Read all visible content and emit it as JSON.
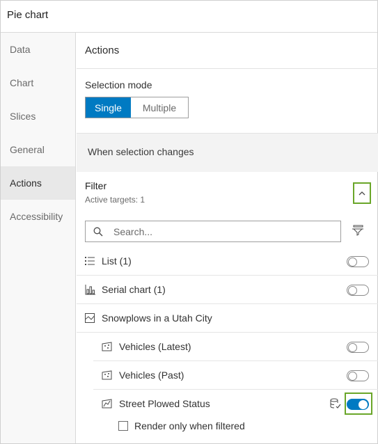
{
  "panel": {
    "title": "Pie chart"
  },
  "sidebar": {
    "items": [
      {
        "label": "Data"
      },
      {
        "label": "Chart"
      },
      {
        "label": "Slices"
      },
      {
        "label": "General"
      },
      {
        "label": "Actions",
        "active": true
      },
      {
        "label": "Accessibility"
      }
    ]
  },
  "main": {
    "title": "Actions",
    "selection_mode": {
      "label": "Selection mode",
      "options": [
        "Single",
        "Multiple"
      ],
      "selected": "Single"
    },
    "when_changes": "When selection changes",
    "filter": {
      "title": "Filter",
      "active_targets": "Active targets: 1",
      "search_placeholder": "Search...",
      "targets": [
        {
          "label": "List (1)",
          "icon": "list-icon",
          "enabled": false
        },
        {
          "label": "Serial chart (1)",
          "icon": "serial-chart-icon",
          "enabled": false
        },
        {
          "label": "Snowplows in a Utah City",
          "icon": "map-icon",
          "group": true
        },
        {
          "label": "Vehicles (Latest)",
          "icon": "point-layer-icon",
          "enabled": false
        },
        {
          "label": "Vehicles (Past)",
          "icon": "point-layer-icon",
          "enabled": false
        },
        {
          "label": "Street Plowed Status",
          "icon": "line-layer-icon",
          "enabled": true
        }
      ],
      "render_only_when_filtered": {
        "label": "Render only when filtered",
        "checked": false
      }
    }
  },
  "colors": {
    "accent": "#007ac2",
    "highlight": "#6aa629"
  }
}
